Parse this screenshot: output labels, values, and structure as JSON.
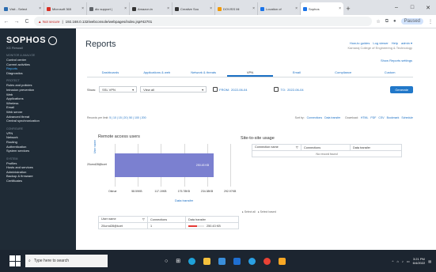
{
  "browser": {
    "tabs": [
      {
        "label": "Visit - Select",
        "color": "#2b6cb0"
      },
      {
        "label": "Microsoft 365",
        "color": "#d93025"
      },
      {
        "label": "dio support |",
        "color": "#5f6368"
      },
      {
        "label": "Amazon.in",
        "color": "#333333"
      },
      {
        "label": "Creative Sou",
        "color": "#333333"
      },
      {
        "label": "DOVISS Mi",
        "color": "#f29900"
      },
      {
        "label": "Location of",
        "color": "#1a73e8"
      },
      {
        "label": "Sophos",
        "color": "#1a73e8",
        "active": true
      }
    ],
    "new_tab": "+",
    "win_min": "–",
    "win_max": "□",
    "win_close": "✕",
    "back": "←",
    "forward": "→",
    "reload": "C",
    "warn": "▲ Not secure",
    "url": "192.168.0.132/webconsole/webpages/index.jsp#42701",
    "paused": "Paused"
  },
  "sidebar": {
    "logo": "SOPHOS",
    "logo_sub": "XG Firewall",
    "sections": [
      {
        "header": "MONITOR & ANALYZE",
        "items": [
          "Control center",
          "Current activities",
          "Reports",
          "Diagnostics"
        ],
        "active": "Reports"
      },
      {
        "header": "PROTECT",
        "items": [
          "Rules and policies",
          "Intrusion prevention",
          "Web",
          "Applications",
          "Wireless",
          "Email",
          "Web server",
          "Advanced threat",
          "Central synchronization"
        ]
      },
      {
        "header": "CONFIGURE",
        "items": [
          "VPN",
          "Network",
          "Routing",
          "Authentication",
          "System services"
        ]
      },
      {
        "header": "SYSTEM",
        "items": [
          "Profiles",
          "Hosts and services",
          "Administration",
          "Backup & firmware",
          "Certificates"
        ]
      }
    ]
  },
  "page": {
    "title": "Reports",
    "top_links": [
      "How-to guides",
      "Log viewer",
      "Help",
      "admin ▾"
    ],
    "org": "Kamaraj College of Engineering & Technology",
    "show_settings": "Show Reports settings"
  },
  "report_tabs": [
    "Dashboards",
    "Applications & web",
    "Network & threats",
    "VPN",
    "Email",
    "Compliance",
    "Custom"
  ],
  "active_tab": "VPN",
  "filters": {
    "show_label": "Show:",
    "show_value": "SSL VPN",
    "view_value": "View all",
    "from_label": "FROM:",
    "from_value": "2022-06-04",
    "to_label": "TO:",
    "to_value": "2022-06-04",
    "generate": "Generate"
  },
  "ops": {
    "records_label": "Records per limit:",
    "records_options": "5 | 10 | 15 | 20 | 50 | 100 | 200",
    "sort_label": "Sort by:",
    "sort_conn": "Connections",
    "sort_data": "Data transfer",
    "download_label": "Download:",
    "downloads": [
      "HTML",
      "PDF",
      "CSV",
      "Bookmark",
      "Schedule"
    ]
  },
  "remote": {
    "title": "Remote access users",
    "chart_data": {
      "type": "bar",
      "orientation": "horizontal",
      "categories": [
        "20urnd28@kcet"
      ],
      "values": [
        250.43
      ],
      "value_label": "250.43 KB",
      "ylabel": "User name",
      "xlabel": "Data transfer",
      "x_ticks": [
        "Oktrue",
        "58.59KB",
        "117.19KB",
        "175.78KB",
        "234.38KB",
        "292.97KB"
      ],
      "xlim": [
        0,
        292.97
      ]
    },
    "select_row": [
      "▸ Select all",
      "▸ Select based"
    ],
    "table": {
      "headers": [
        "User name",
        "Connections",
        "Data transfer"
      ],
      "rows": [
        {
          "user": "20urnd28@kcet",
          "connections": "1",
          "data": "250.43 KB",
          "fill": 0.55
        }
      ]
    }
  },
  "site": {
    "title": "Site-to-site usage",
    "headers": [
      "Connection name",
      "Connections",
      "Data transfer"
    ],
    "empty": "No record found"
  },
  "taskbar": {
    "search": "Type here to search",
    "time": "3:21 PM",
    "date": "6/4/2022"
  }
}
